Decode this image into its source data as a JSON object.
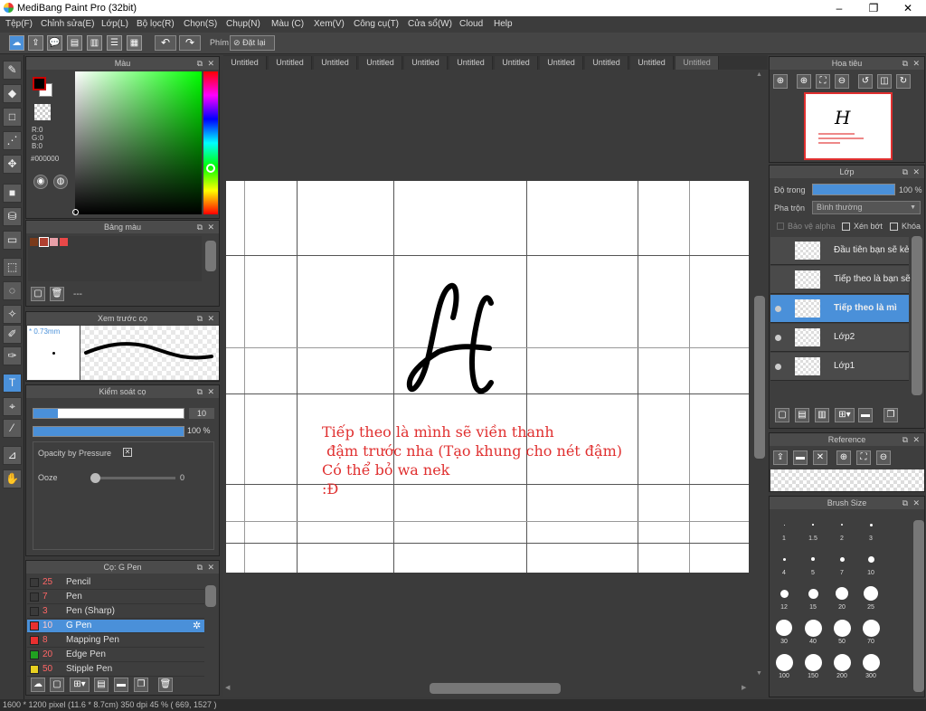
{
  "window": {
    "title": "MediBang Paint Pro (32bit)",
    "minimize": "–",
    "maximize": "❐",
    "close": "✕"
  },
  "menu": [
    "Tệp(F)",
    "Chỉnh sửa(E)",
    "Lớp(L)",
    "Bộ lọc(R)",
    "Chọn(S)",
    "Chụp(N)",
    "Màu (C)",
    "Xem(V)",
    "Công cụ(T)",
    "Cửa sổ(W)",
    "Cloud",
    "Help"
  ],
  "toolbar": {
    "shortcut_label": "Phím",
    "reset_label": "Đặt lại"
  },
  "tabs": [
    "Untitled",
    "Untitled",
    "Untitled",
    "Untitled",
    "Untitled",
    "Untitled",
    "Untitled",
    "Untitled",
    "Untitled",
    "Untitled",
    "Untitled"
  ],
  "color_panel": {
    "title": "Màu",
    "r": "R:0",
    "g": "G:0",
    "b": "B:0",
    "hex": "#000000"
  },
  "palette_panel": {
    "title": "Bảng màu",
    "swatches": [
      "#7a3a1a",
      "#b04030",
      "#e8a0a8",
      "#e84848"
    ],
    "dash": "---"
  },
  "brush_preview": {
    "title": "Xem trước cọ",
    "size": "* 0.73mm"
  },
  "brush_control": {
    "title": "Kiểm soát cọ",
    "size_value": "10",
    "opacity_value": "100 %",
    "size_fraction": 0.16,
    "opacity_fraction": 1.0,
    "pressure_label": "Opacity by Pressure",
    "ooze_label": "Ooze",
    "ooze_value": "0"
  },
  "brush_list": {
    "title": "Cọ: G Pen",
    "items": [
      {
        "size": "25",
        "name": "Pencil",
        "color": "#3a3a3a"
      },
      {
        "size": "7",
        "name": "Pen",
        "color": "#3a3a3a"
      },
      {
        "size": "3",
        "name": "Pen (Sharp)",
        "color": "#3a3a3a"
      },
      {
        "size": "10",
        "name": "G Pen",
        "color": "#e83030"
      },
      {
        "size": "8",
        "name": "Mapping Pen",
        "color": "#e83030"
      },
      {
        "size": "20",
        "name": "Edge Pen",
        "color": "#20a020"
      },
      {
        "size": "50",
        "name": "Stipple Pen",
        "color": "#e8d020"
      }
    ]
  },
  "canvas": {
    "notes": [
      "Tiếp theo là mình sẽ viền thanh",
      " đậm trước nha (Tạo khung cho nét đậm)",
      "Có thể bỏ wa nek",
      ":Đ"
    ]
  },
  "navigator": {
    "title": "Hoa tiêu"
  },
  "layers": {
    "title": "Lớp",
    "opacity_label": "Độ trong",
    "opacity_value": "100 %",
    "blend_label": "Pha trộn",
    "blend_value": "Bình thường",
    "protect_alpha": "Bảo vệ alpha",
    "clipping": "Xén bớt",
    "lock": "Khóa",
    "items": [
      {
        "name": "Đầu tiên bạn sẽ kẻ"
      },
      {
        "name": "Tiếp theo là bạn sẽ"
      },
      {
        "name": "Tiếp theo là mì"
      },
      {
        "name": "Lớp2"
      },
      {
        "name": "Lớp1"
      }
    ]
  },
  "reference": {
    "title": "Reference"
  },
  "brush_size": {
    "title": "Brush Size",
    "sizes": [
      "1",
      "1.5",
      "2",
      "3",
      "4",
      "5",
      "7",
      "10",
      "12",
      "15",
      "20",
      "25",
      "30",
      "40",
      "50",
      "70",
      "100",
      "150",
      "200",
      "300"
    ]
  },
  "status": {
    "text": "1600 * 1200 pixel  (11.6 * 8.7cm)  350 dpi  45 %  ( 669, 1527 )"
  }
}
